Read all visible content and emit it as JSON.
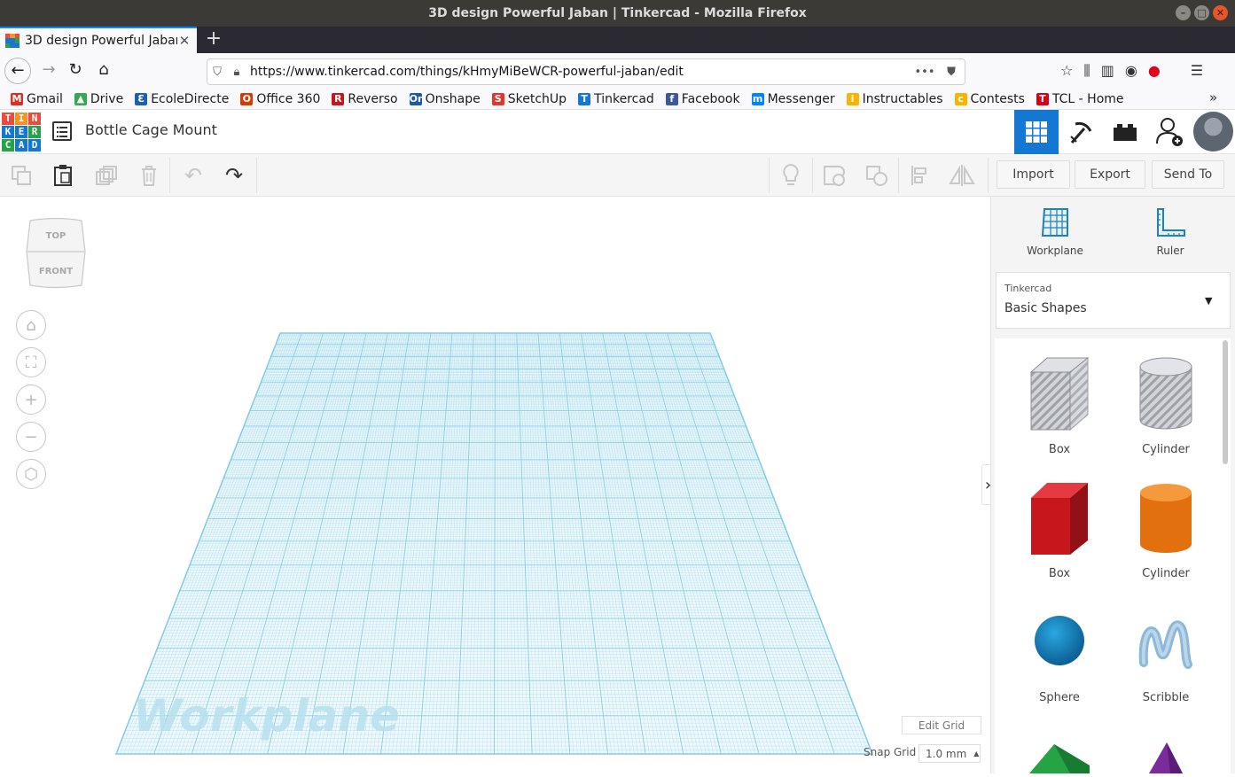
{
  "window": {
    "title": "3D design Powerful Jaban | Tinkercad - Mozilla Firefox",
    "controls": [
      "–",
      "□",
      "✕"
    ]
  },
  "browser": {
    "tab_title": "3D design Powerful Jaban | Tinkercad",
    "tab_close": "✕",
    "new_tab": "+",
    "url": "https://www.tinkercad.com/things/kHmyMiBeWCR-powerful-jaban/edit",
    "url_more": "•••",
    "bookmarks": [
      {
        "label": "Gmail",
        "icon": "gmail-icon",
        "color": "#d93025",
        "glyph": "M"
      },
      {
        "label": "Drive",
        "icon": "drive-icon",
        "color": "#34a853",
        "glyph": "▲"
      },
      {
        "label": "EcoleDirecte",
        "icon": "ecoledirecte-icon",
        "color": "#1f5fb0",
        "glyph": "Ɛ"
      },
      {
        "label": "Office 360",
        "icon": "office-icon",
        "color": "#d83b01",
        "glyph": "O"
      },
      {
        "label": "Reverso",
        "icon": "reverso-icon",
        "color": "#c4161c",
        "glyph": "R"
      },
      {
        "label": "Onshape",
        "icon": "onshape-icon",
        "color": "#1a5aa6",
        "glyph": "On"
      },
      {
        "label": "SketchUp",
        "icon": "sketchup-icon",
        "color": "#e0362c",
        "glyph": "S"
      },
      {
        "label": "Tinkercad",
        "icon": "tinkercad-icon",
        "color": "#1477d1",
        "glyph": "T"
      },
      {
        "label": "Facebook",
        "icon": "facebook-icon",
        "color": "#3b5998",
        "glyph": "f"
      },
      {
        "label": "Messenger",
        "icon": "messenger-icon",
        "color": "#0084ff",
        "glyph": "m"
      },
      {
        "label": "Instructables",
        "icon": "instructables-icon",
        "color": "#f7b500",
        "glyph": "i"
      },
      {
        "label": "Contests",
        "icon": "contests-icon",
        "color": "#f7b500",
        "glyph": "c"
      },
      {
        "label": "TCL - Home",
        "icon": "tcl-icon",
        "color": "#d6001c",
        "glyph": "T"
      }
    ],
    "bookmarks_more": "»"
  },
  "tinkercad": {
    "logo_letters": [
      "T",
      "I",
      "N",
      "K",
      "E",
      "R",
      "C",
      "A",
      "D"
    ],
    "logo_colors": [
      "#e84c3d",
      "#f7931e",
      "#e84c3d",
      "#1477d1",
      "#1477d1",
      "#27a24a",
      "#27a24a",
      "#1477d1",
      "#1477d1"
    ],
    "design_title": "Bottle Cage Mount",
    "buttons": {
      "import": "Import",
      "export": "Export",
      "send_to": "Send To"
    },
    "viewcube": {
      "top": "TOP",
      "front": "FRONT"
    },
    "workplane_label": "Workplane",
    "edit_grid": "Edit Grid",
    "snap_grid_label": "Snap Grid",
    "snap_grid_value": "1.0 mm",
    "panel": {
      "workplane": "Workplane",
      "ruler": "Ruler",
      "category_small": "Tinkercad",
      "category": "Basic Shapes",
      "shapes": [
        {
          "label": "Box",
          "icon": "box-hole-icon"
        },
        {
          "label": "Cylinder",
          "icon": "cylinder-hole-icon"
        },
        {
          "label": "Box",
          "icon": "box-solid-icon"
        },
        {
          "label": "Cylinder",
          "icon": "cylinder-solid-icon"
        },
        {
          "label": "Sphere",
          "icon": "sphere-icon"
        },
        {
          "label": "Scribble",
          "icon": "scribble-icon"
        }
      ]
    },
    "accent": "#1477d1",
    "grid_color": "#7fcbe3"
  }
}
